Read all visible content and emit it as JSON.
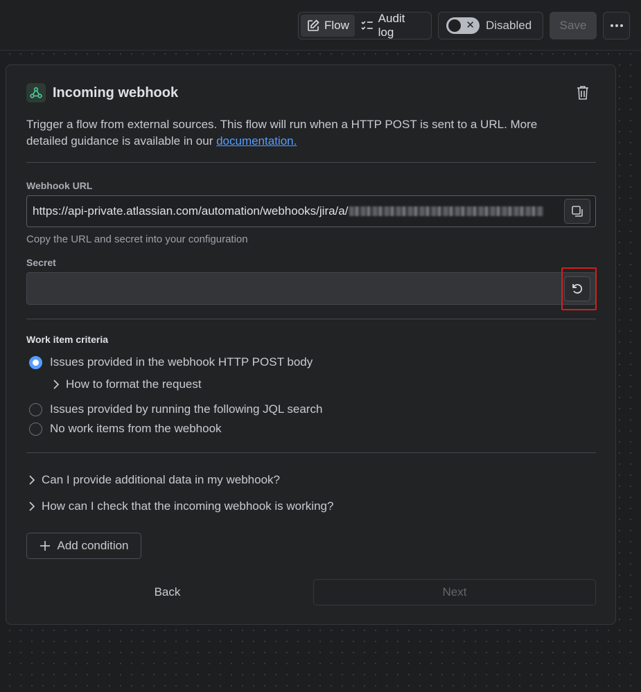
{
  "topbar": {
    "flow_label": "Flow",
    "audit_label": "Audit log",
    "toggle_label": "Disabled",
    "save_label": "Save"
  },
  "panel": {
    "title": "Incoming webhook",
    "description_prefix": "Trigger a flow from external sources. This flow will run when a HTTP POST is sent to a URL. More detailed guidance is available in our ",
    "doc_link": "documentation.",
    "webhook_url_label": "Webhook URL",
    "webhook_url_value": "https://api-private.atlassian.com/automation/webhooks/jira/a/",
    "copy_hint": "Copy the URL and secret into your configuration",
    "secret_label": "Secret",
    "criteria_label": "Work item criteria",
    "options": [
      {
        "label": "Issues provided in the webhook HTTP POST body",
        "checked": true
      },
      {
        "label": "Issues provided by running the following JQL search",
        "checked": false
      },
      {
        "label": "No work items from the webhook",
        "checked": false
      }
    ],
    "format_expander": "How to format the request",
    "faq": [
      "Can I provide additional data in my webhook?",
      "How can I check that the incoming webhook is working?"
    ],
    "add_condition": "Add condition",
    "back": "Back",
    "next": "Next"
  },
  "colors": {
    "accent": "#579dff",
    "highlight": "#d21f1f"
  }
}
